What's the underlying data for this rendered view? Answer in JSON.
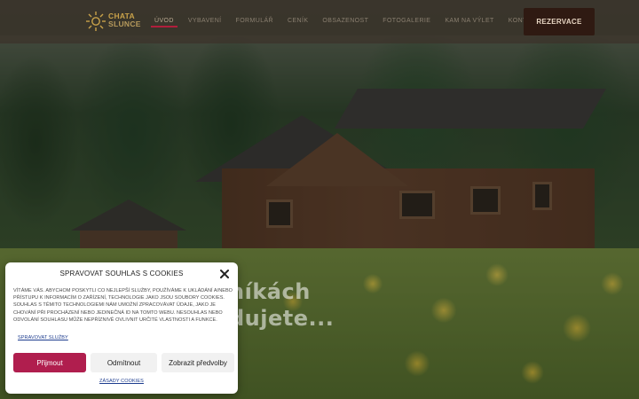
{
  "header": {
    "logo": {
      "line1": "CHATA",
      "line2": "SLUNCE"
    },
    "nav": [
      {
        "label": "ÚVOD",
        "active": true
      },
      {
        "label": "VYBAVENÍ",
        "active": false
      },
      {
        "label": "FORMULÁŘ",
        "active": false
      },
      {
        "label": "CENÍK",
        "active": false
      },
      {
        "label": "OBSAZENOST",
        "active": false
      },
      {
        "label": "FOTOGALERIE",
        "active": false
      },
      {
        "label": "KAM NA VÝLET",
        "active": false
      },
      {
        "label": "KONTAKT",
        "active": false
      }
    ],
    "cta_label": "REZERVACE"
  },
  "hero": {
    "line1": "níkách",
    "line2": "dujete..."
  },
  "cookie": {
    "title": "SPRAVOVAT SOUHLAS S COOKIES",
    "text": "VÍTÁME VÁS. ABYCHOM POSKYTLI CO NEJLEPŠÍ SLUŽBY, POUŽÍVÁME K UKLÁDÁNÍ A/NEBO PŘÍSTUPU K INFORMACÍM O ZAŘÍZENÍ, TECHNOLOGIE JAKO JSOU SOUBORY COOKIES. SOUHLAS S TĚMITO TECHNOLOGIEMI NÁM UMOŽNÍ ZPRACOVÁVAT ÚDAJE, JAKO JE CHOVÁNÍ PŘI PROCHÁZENÍ NEBO JEDINEČNÁ ID NA TOMTO WEBU. NESOUHLAS NEBO ODVOLÁNÍ SOUHLASU MŮŽE NEPŘÍZNIVĚ OVLIVNIT URČITÉ VLASTNOSTI A FUNKCE.",
    "manage_label": "SPRAVOVAT SLUŽBY",
    "accept_label": "Přijmout",
    "deny_label": "Odmítnout",
    "prefs_label": "Zobrazit předvolby",
    "policy_label": "ZÁSADY COOKIES"
  },
  "colors": {
    "accent": "#b01e4e",
    "nav_underline": "#b01e3c",
    "cta_bg": "#2f1a12",
    "logo_gold": "#c9a24a",
    "link": "#1e3d8f"
  },
  "icons": {
    "logo": "sun-logo-icon",
    "close": "close-icon"
  }
}
